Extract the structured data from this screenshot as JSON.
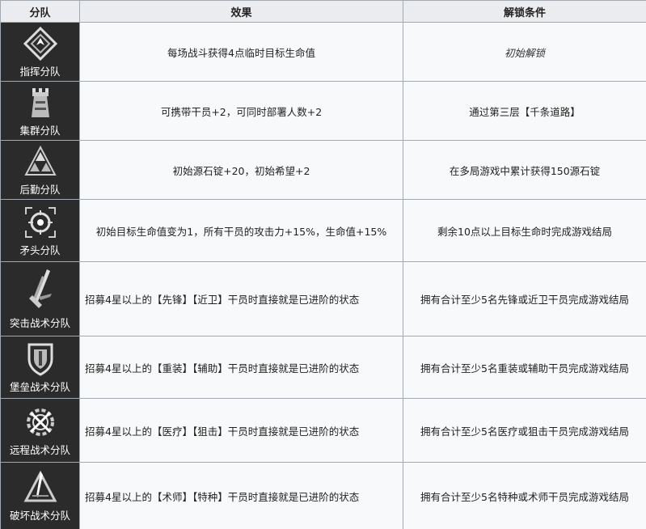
{
  "headers": {
    "squad": "分队",
    "effect": "效果",
    "unlock": "解锁条件"
  },
  "rows": [
    {
      "name": "指挥分队",
      "icon": "diamond-compass-icon",
      "effect": "每场战斗获得4点临时目标生命值",
      "unlock": "初始解锁"
    },
    {
      "name": "集群分队",
      "icon": "tower-icon",
      "effect": "可携带干员+2，可同时部署人数+2",
      "unlock": "通过第三层【千条道路】"
    },
    {
      "name": "后勤分队",
      "icon": "triangle-stack-icon",
      "effect": "初始源石锭+20，初始希望+2",
      "unlock": "在多局游戏中累计获得150源石锭"
    },
    {
      "name": "矛头分队",
      "icon": "crosshair-icon",
      "effect": "初始目标生命值变为1，所有干员的攻击力+15%，生命值+15%",
      "unlock": "剩余10点以上目标生命时完成游戏结局"
    },
    {
      "name": "突击战术分队",
      "icon": "blade-icon",
      "effect": "招募4星以上的【先锋】【近卫】干员时直接就是已进阶的状态",
      "unlock": "拥有合计至少5名先锋或近卫干员完成游戏结局"
    },
    {
      "name": "堡垒战术分队",
      "icon": "shield-icon",
      "effect": "招募4星以上的【重装】【辅助】干员时直接就是已进阶的状态",
      "unlock": "拥有合计至少5名重装或辅助干员完成游戏结局"
    },
    {
      "name": "远程战术分队",
      "icon": "gear-cross-icon",
      "effect": "招募4星以上的【医疗】【狙击】干员时直接就是已进阶的状态",
      "unlock": "拥有合计至少5名医疗或狙击干员完成游戏结局"
    },
    {
      "name": "破坏战术分队",
      "icon": "triangle-blade-icon",
      "effect": "招募4星以上的【术师】【特种】干员时直接就是已进阶的状态",
      "unlock": "拥有合计至少5名特种或术师干员完成游戏结局"
    }
  ]
}
